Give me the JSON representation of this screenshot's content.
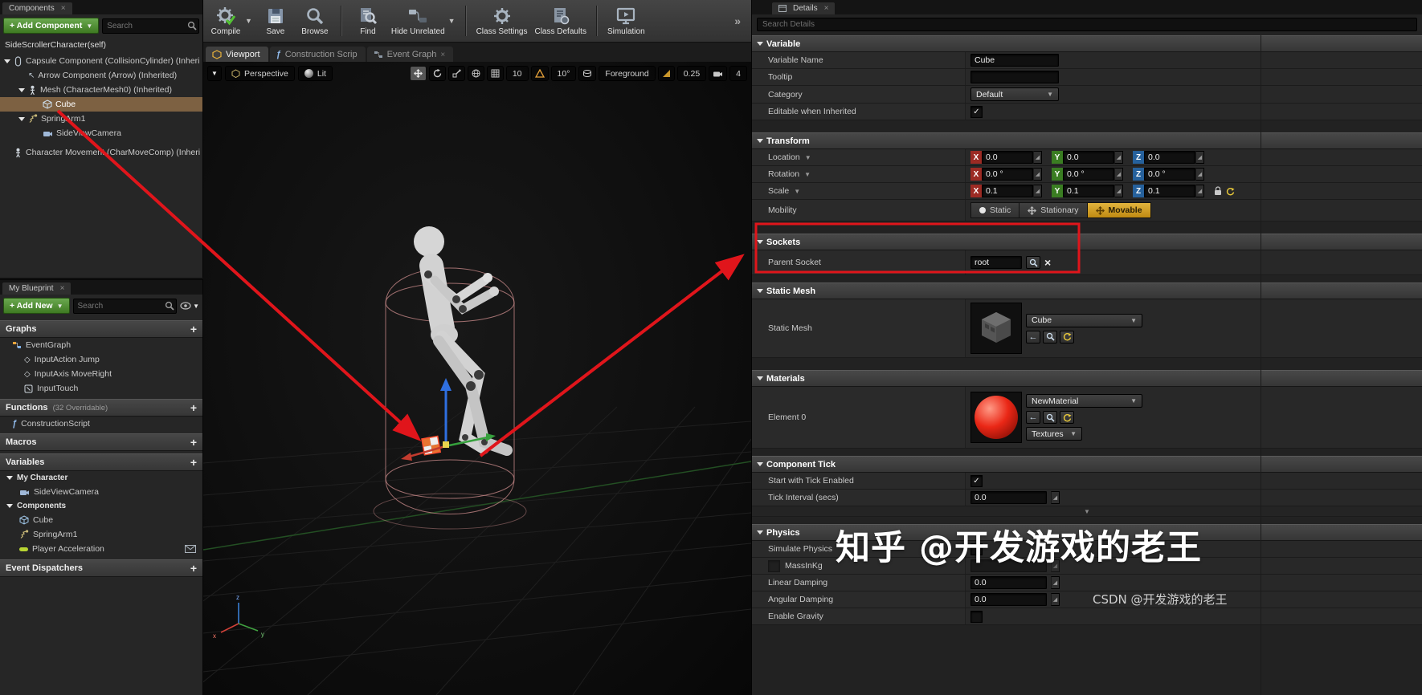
{
  "colors": {
    "selection_highlight": "#7d6142",
    "mobility_active": "#cf9a1d",
    "annotation_red": "#e0151b",
    "add_button_green": "#4f8f2f",
    "axis_x": "#9c2b24",
    "axis_y": "#3a7d22",
    "axis_z": "#26619c"
  },
  "watermark": {
    "zhihu": "知乎 @开发游戏的老王",
    "csdn": "CSDN @开发游戏的老王"
  },
  "components_panel": {
    "tab_label": "Components",
    "add_component_label": "+ Add Component",
    "search_placeholder": "Search",
    "self_row_label": "SideScrollerCharacter(self)",
    "tree": [
      {
        "label": "Capsule Component (CollisionCylinder) (Inheri"
      },
      {
        "label": "Arrow Component (Arrow) (Inherited)"
      },
      {
        "label": "Mesh (CharacterMesh0) (Inherited)"
      },
      {
        "label": "Cube"
      },
      {
        "label": "SpringArm1"
      },
      {
        "label": "SideViewCamera"
      },
      {
        "label": "Character Movement (CharMoveComp) (Inheri"
      }
    ]
  },
  "my_blueprint_panel": {
    "tab_label": "My Blueprint",
    "add_new_label": "+ Add New",
    "search_placeholder": "Search",
    "graphs": {
      "header": "Graphs",
      "items": [
        {
          "label": "EventGraph"
        },
        {
          "label": "InputAction Jump"
        },
        {
          "label": "InputAxis MoveRight"
        },
        {
          "label": "InputTouch"
        }
      ]
    },
    "functions": {
      "header": "Functions",
      "note": "(32 Overridable)",
      "items": [
        {
          "label": "ConstructionScript"
        }
      ]
    },
    "macros": {
      "header": "Macros"
    },
    "variables": {
      "header": "Variables",
      "groups": [
        {
          "label": "My Character",
          "items": [
            {
              "label": "SideViewCamera"
            }
          ]
        },
        {
          "label": "Components",
          "items": [
            {
              "label": "Cube"
            },
            {
              "label": "SpringArm1"
            },
            {
              "label": "Player Acceleration"
            }
          ]
        }
      ]
    },
    "event_dispatchers": {
      "header": "Event Dispatchers"
    }
  },
  "toolbar": {
    "compile": "Compile",
    "save": "Save",
    "browse": "Browse",
    "find": "Find",
    "hide_unrelated": "Hide Unrelated",
    "class_settings": "Class Settings",
    "class_defaults": "Class Defaults",
    "simulation": "Simulation",
    "overflow": "»"
  },
  "editor_tabs": [
    {
      "label": "Viewport",
      "active": true
    },
    {
      "label": "Construction Scrip",
      "active": false
    },
    {
      "label": "Event Graph",
      "active": false
    }
  ],
  "viewport_toolbar": {
    "perspective": "Perspective",
    "lit": "Lit",
    "grid_snap": "10",
    "rotation_snap": "10°",
    "layer_snap": "Foreground",
    "scale_snap": "0.25",
    "camera_speed": "4"
  },
  "details_panel": {
    "tab_label": "Details",
    "search_placeholder": "Search Details",
    "variable_section": {
      "header": "Variable",
      "variable_name_label": "Variable Name",
      "variable_name_value": "Cube",
      "tooltip_label": "Tooltip",
      "tooltip_value": "",
      "category_label": "Category",
      "category_value": "Default",
      "editable_label": "Editable when Inherited",
      "editable_checked": true
    },
    "transform_section": {
      "header": "Transform",
      "axis_labels": {
        "x": "X",
        "y": "Y",
        "z": "Z"
      },
      "location_label": "Location",
      "location": {
        "x": "0.0",
        "y": "0.0",
        "z": "0.0"
      },
      "rotation_label": "Rotation",
      "rotation": {
        "x": "0.0 °",
        "y": "0.0 °",
        "z": "0.0 °"
      },
      "scale_label": "Scale",
      "scale": {
        "x": "0.1",
        "y": "0.1",
        "z": "0.1"
      },
      "mobility_label": "Mobility",
      "mobility_options": [
        {
          "label": "Static",
          "selected": false
        },
        {
          "label": "Stationary",
          "selected": false
        },
        {
          "label": "Movable",
          "selected": true
        }
      ]
    },
    "sockets_section": {
      "header": "Sockets",
      "parent_socket_label": "Parent Socket",
      "parent_socket_value": "root"
    },
    "static_mesh_section": {
      "header": "Static Mesh",
      "static_mesh_label": "Static Mesh",
      "static_mesh_value": "Cube"
    },
    "materials_section": {
      "header": "Materials",
      "element0_label": "Element 0",
      "element0_value": "NewMaterial",
      "textures_label": "Textures"
    },
    "component_tick_section": {
      "header": "Component Tick",
      "start_tick_label": "Start with Tick Enabled",
      "start_tick_checked": true,
      "tick_interval_label": "Tick Interval (secs)",
      "tick_interval_value": "0.0"
    },
    "physics_section": {
      "header": "Physics",
      "simulate_physics_label": "Simulate Physics",
      "simulate_physics_checked": false,
      "mass_label": "MassInKg",
      "mass_value": "",
      "linear_damping_label": "Linear Damping",
      "linear_damping_value": "0.0",
      "angular_damping_label": "Angular Damping",
      "angular_damping_value": "0.0",
      "enable_gravity_label": "Enable Gravity",
      "enable_gravity_checked": false
    }
  }
}
